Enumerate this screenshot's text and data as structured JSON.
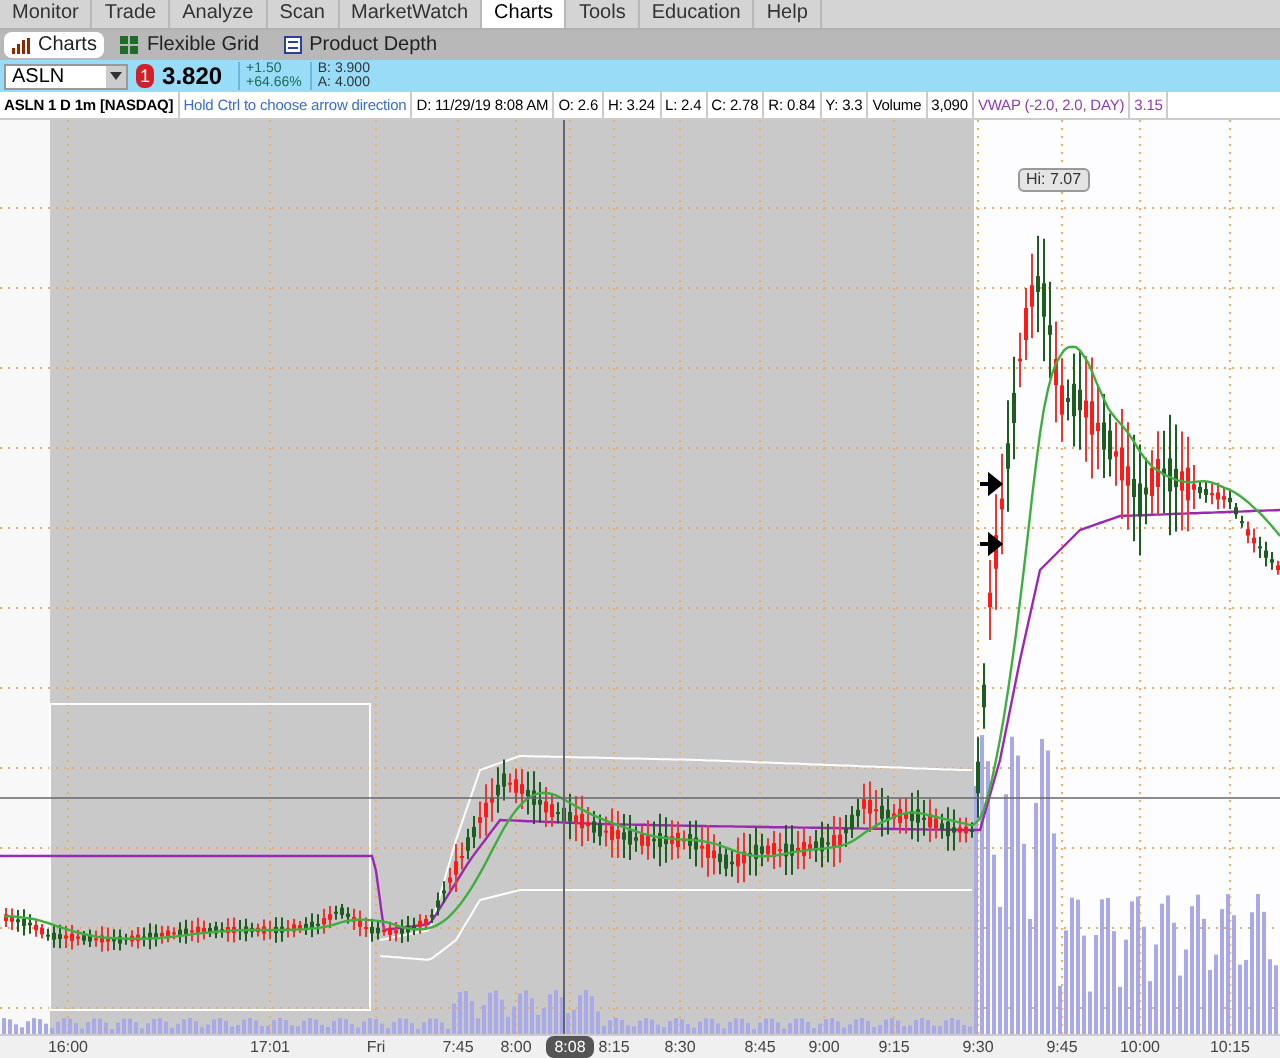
{
  "top_tabs": [
    {
      "label": "Monitor",
      "selected": false
    },
    {
      "label": "Trade",
      "selected": false
    },
    {
      "label": "Analyze",
      "selected": false
    },
    {
      "label": "Scan",
      "selected": false
    },
    {
      "label": "MarketWatch",
      "selected": false
    },
    {
      "label": "Charts",
      "selected": true
    },
    {
      "label": "Tools",
      "selected": false
    },
    {
      "label": "Education",
      "selected": false
    },
    {
      "label": "Help",
      "selected": false
    }
  ],
  "sub_tabs": [
    {
      "label": "Charts",
      "selected": true
    },
    {
      "label": "Flexible Grid",
      "selected": false
    },
    {
      "label": "Product Depth",
      "selected": false
    }
  ],
  "symbol_bar": {
    "symbol": "ASLN",
    "alert_badge": "1",
    "last": "3.820",
    "change": "+1.50",
    "change_pct": "+64.66%",
    "bid": "B: 3.900",
    "ask": "A: 4.000"
  },
  "info_bar": [
    {
      "text": "ASLN 1 D 1m [NASDAQ]",
      "kind": "title"
    },
    {
      "text": "Hold Ctrl to choose arrow direction",
      "kind": "hint"
    },
    {
      "text": "D: 11/29/19 8:08 AM",
      "kind": "plain"
    },
    {
      "text": "O: 2.6",
      "kind": "plain"
    },
    {
      "text": "H: 3.24",
      "kind": "plain"
    },
    {
      "text": "L: 2.4",
      "kind": "plain"
    },
    {
      "text": "C: 2.78",
      "kind": "plain"
    },
    {
      "text": "R: 0.84",
      "kind": "plain"
    },
    {
      "text": "Y: 3.3",
      "kind": "plain"
    },
    {
      "text": "Volume",
      "kind": "plain"
    },
    {
      "text": "3,090",
      "kind": "plain"
    },
    {
      "text": "VWAP (-2.0, 2.0, DAY)",
      "kind": "study"
    },
    {
      "text": "3.15",
      "kind": "study"
    }
  ],
  "chart": {
    "high_label": "Hi: 7.07",
    "time_labels": [
      {
        "label": "16:00",
        "selected": false
      },
      {
        "label": "17:01",
        "selected": false
      },
      {
        "label": "Fri",
        "selected": false
      },
      {
        "label": "7:45",
        "selected": false
      },
      {
        "label": "8:00",
        "selected": false
      },
      {
        "label": "8:08",
        "selected": true
      },
      {
        "label": "8:15",
        "selected": false
      },
      {
        "label": "8:30",
        "selected": false
      },
      {
        "label": "8:45",
        "selected": false
      },
      {
        "label": "9:00",
        "selected": false
      },
      {
        "label": "9:15",
        "selected": false
      },
      {
        "label": "9:30",
        "selected": false
      },
      {
        "label": "9:45",
        "selected": false
      },
      {
        "label": "10:00",
        "selected": false
      },
      {
        "label": "10:15",
        "selected": false
      }
    ]
  }
}
